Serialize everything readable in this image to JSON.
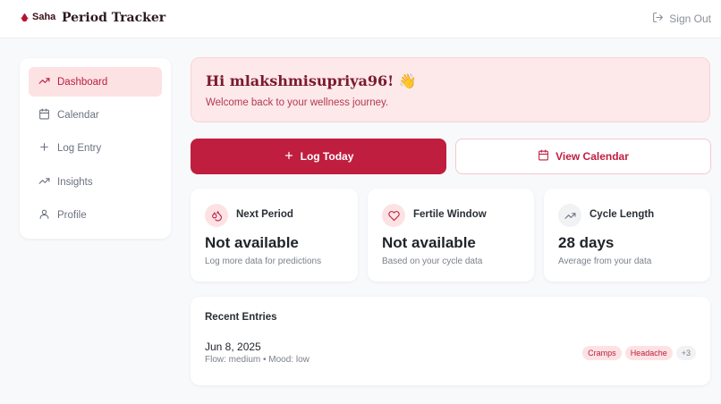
{
  "header": {
    "logo_text": "Saha",
    "logo_icon": "drop-icon",
    "app_title": "Period Tracker",
    "signout_label": "Sign Out"
  },
  "sidebar": {
    "items": [
      {
        "label": "Dashboard",
        "icon": "trending-up-icon",
        "active": true
      },
      {
        "label": "Calendar",
        "icon": "calendar-icon",
        "active": false
      },
      {
        "label": "Log Entry",
        "icon": "plus-icon",
        "active": false
      },
      {
        "label": "Insights",
        "icon": "trending-up-icon",
        "active": false
      },
      {
        "label": "Profile",
        "icon": "user-icon",
        "active": false
      }
    ]
  },
  "welcome": {
    "title": "Hi mlakshmisupriya96! 👋",
    "subtitle": "Welcome back to your wellness journey."
  },
  "actions": {
    "log_today": "Log Today",
    "view_calendar": "View Calendar"
  },
  "stats": [
    {
      "title": "Next Period",
      "value": "Not available",
      "note": "Log more data for predictions",
      "icon": "droplets-icon"
    },
    {
      "title": "Fertile Window",
      "value": "Not available",
      "note": "Based on your cycle data",
      "icon": "heart-icon"
    },
    {
      "title": "Cycle Length",
      "value": "28 days",
      "note": "Average from your data",
      "icon": "trending-up-icon"
    }
  ],
  "recent": {
    "title": "Recent Entries",
    "entries": [
      {
        "date": "Jun 8, 2025",
        "meta": "Flow: medium • Mood: low",
        "tags": [
          "Cramps",
          "Headache"
        ],
        "more": "+3"
      }
    ]
  },
  "colors": {
    "accent": "#bf1e3f",
    "accent_soft": "#fde2e4",
    "background": "#f8f9fa"
  }
}
